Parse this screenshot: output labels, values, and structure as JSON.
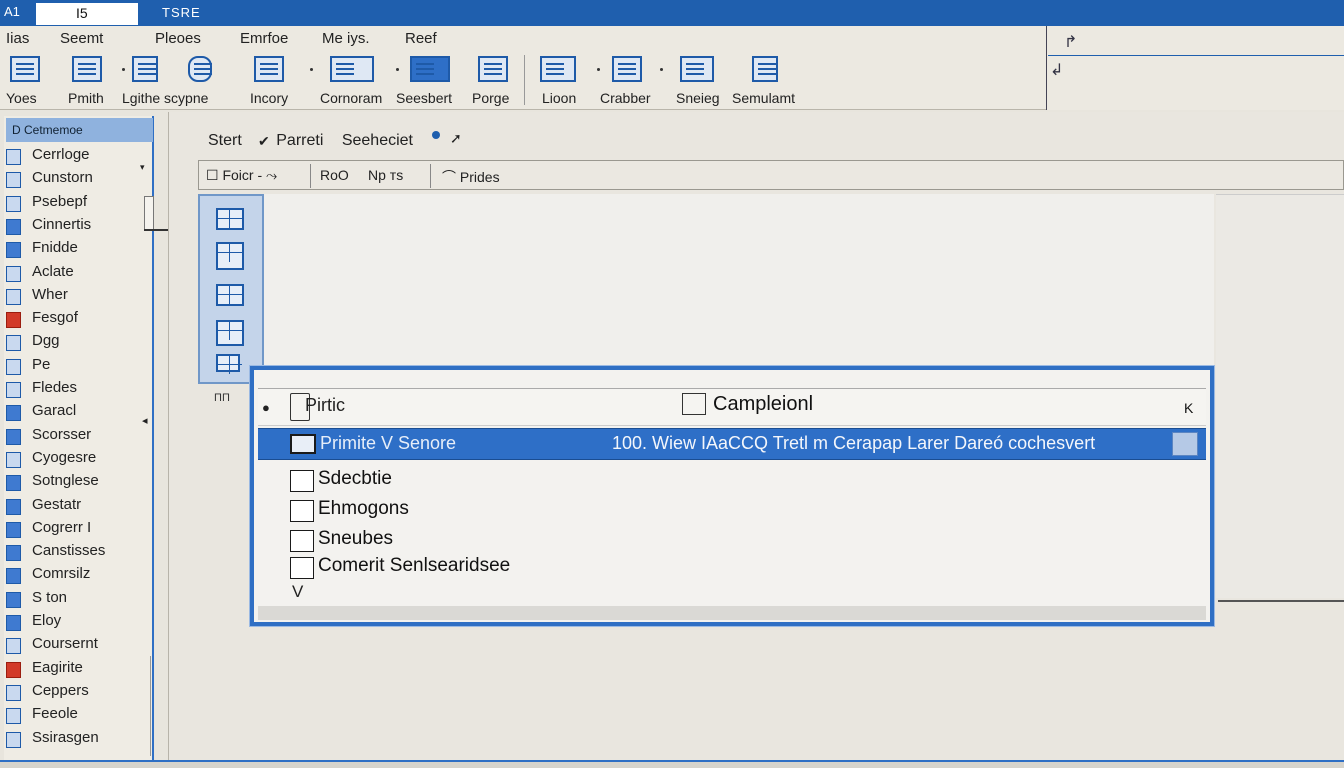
{
  "titlebar": {
    "cell_ref": "A1",
    "cell_value": "I5",
    "tab_title": "TSRE"
  },
  "menu": [
    "Iias",
    "Seemt",
    "Pleoes",
    "Emrfoe",
    "Me iys.",
    "Reef"
  ],
  "ribbon": [
    "Yoes",
    "Pmith",
    "Lgithe scypne",
    "Incory",
    "Cornoram",
    "Seesbert",
    "Porge",
    "Lioon",
    "Crabber",
    "Sneieg",
    "Semulamt"
  ],
  "right_panel": {
    "arrows": [
      "↱",
      "↲"
    ]
  },
  "sidebar": {
    "header": "D Cetmemoe",
    "items": [
      "Cerrloge",
      "Cunstorn",
      "Psebepf",
      "Cinnertis",
      "Fnidde",
      "Aclate",
      "Wher",
      "Fesgof",
      "Dgg",
      "Pe",
      "Fledes",
      "Garacl",
      "Scorsser",
      "Cyogesre",
      "Sotnglese",
      "Gestatr",
      "Cogrerr I",
      "Canstisses",
      "Comrsilz",
      "Ѕ ton",
      "Eloy",
      "Coursernt",
      "Eagirite",
      "Ceppers",
      "Feeole",
      "Ssirasgen"
    ]
  },
  "crumb": {
    "label1": "Stert",
    "label2": "Parreti",
    "label3": "Seeheciet"
  },
  "toolbar2": {
    "btn1": "Foicr -",
    "btn2": "RoO",
    "btn3": "Nр тs",
    "btn4": "Prides"
  },
  "palette": {
    "small_label": "ΠΠ"
  },
  "dialog": {
    "header_label": "Pirtic",
    "title": "Campleionl",
    "close": "K",
    "selected_name": "Primite V Senore",
    "selected_detail": "100. Wiew IAaCCQ Tretl  m  Cerapap Larer Dareó cochesvert",
    "options": [
      "Sdecbtie",
      "Ehmogons",
      "Sneubes",
      "Comerit Senlsearidsee"
    ],
    "last_icon": "V"
  },
  "colors": {
    "accent": "#2f6fc4",
    "titlebar": "#1f5fae",
    "selection": "#2e6fc7"
  }
}
